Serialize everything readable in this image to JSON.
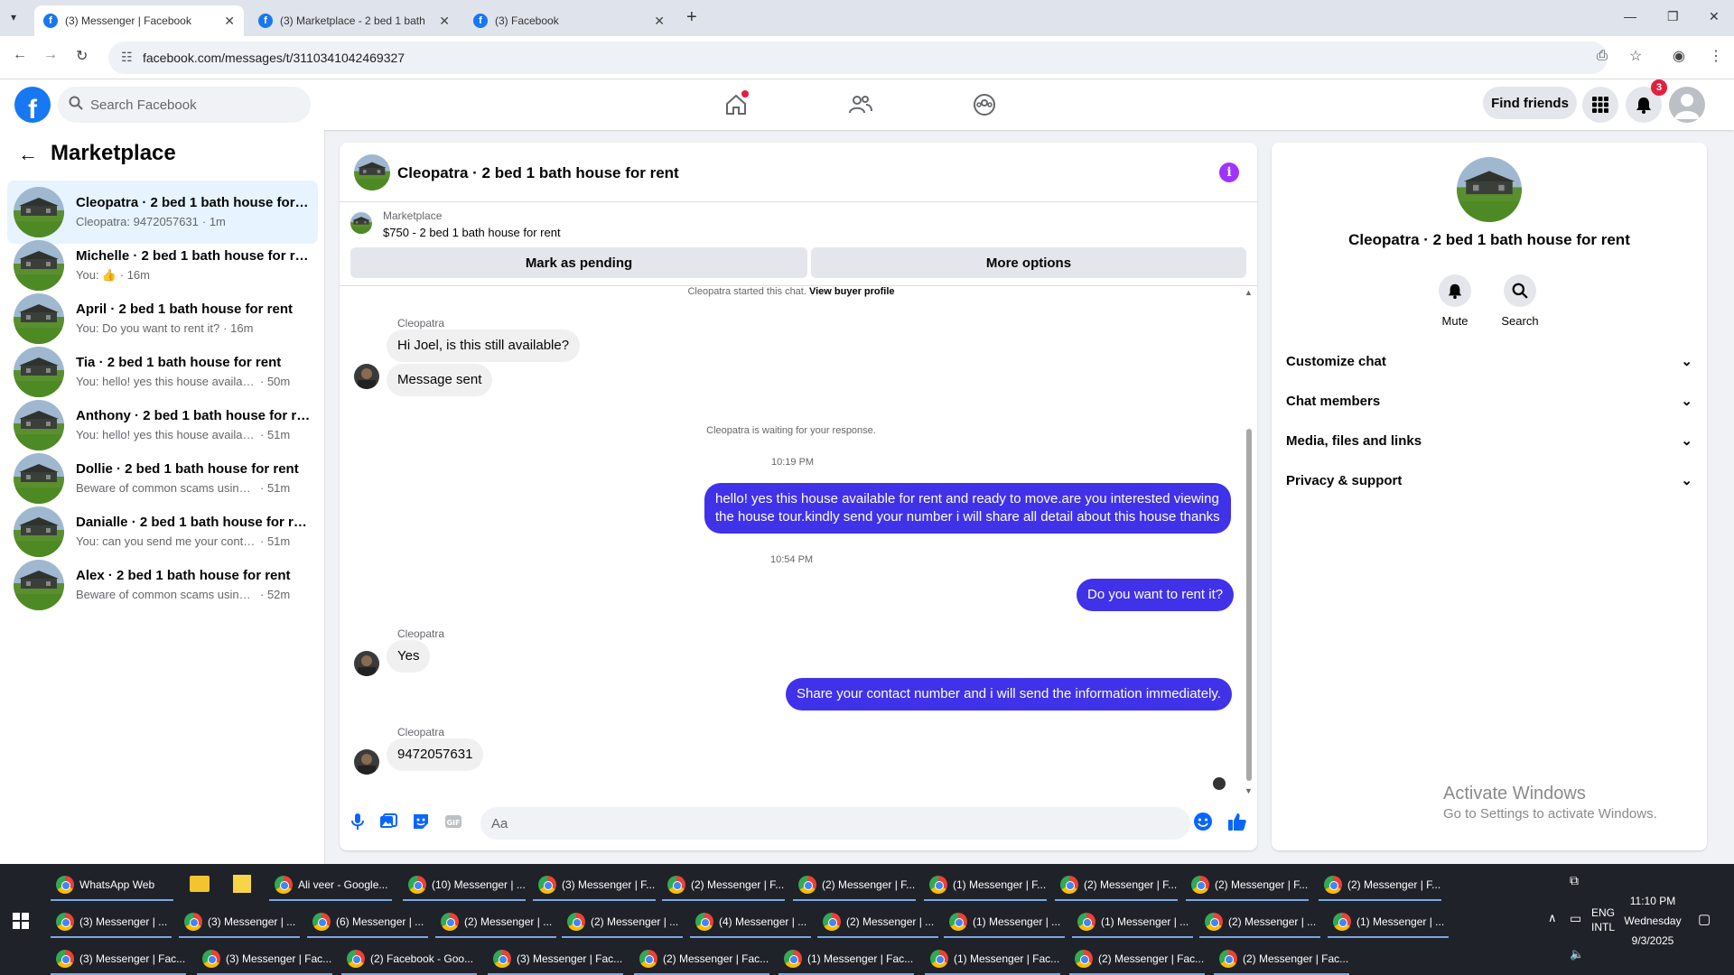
{
  "browser": {
    "tabs": [
      {
        "title": "(3) Messenger | Facebook"
      },
      {
        "title": "(3) Marketplace - 2 bed 1 bath"
      },
      {
        "title": "(3) Facebook"
      }
    ],
    "new_tab": "+",
    "url": "facebook.com/messages/t/3110341042469327"
  },
  "fb": {
    "search_placeholder": "Search Facebook",
    "find_friends": "Find friends",
    "notif_count": "3"
  },
  "sidebar": {
    "title": "Marketplace",
    "conversations": [
      {
        "name": "Cleopatra · 2 bed 1 bath house for rent",
        "snippet": "Cleopatra: 9472057631",
        "time": "· 1m",
        "selected": true
      },
      {
        "name": "Michelle · 2 bed 1 bath house for rent",
        "snippet": "You:",
        "time": "· 16m",
        "thumb": true
      },
      {
        "name": "April · 2 bed 1 bath house for rent",
        "snippet": "You: Do you want to rent it?",
        "time": " · 16m"
      },
      {
        "name": "Tia · 2 bed 1 bath house for rent",
        "snippet": "You: hello! yes this house available for rent",
        "time": "· 50m"
      },
      {
        "name": "Anthony · 2 bed 1 bath house for rent",
        "snippet": "You: hello! yes this house available for rent",
        "time": "· 51m"
      },
      {
        "name": "Dollie · 2 bed 1 bath house for rent",
        "snippet": "Beware of common scams using payment apps",
        "time": "· 51m"
      },
      {
        "name": "Danialle · 2 bed 1 bath house for rent",
        "snippet": "You: can you send me your contact number",
        "time": "· 51m"
      },
      {
        "name": "Alex · 2 bed 1 bath house for rent",
        "snippet": "Beware of common scams using payment apps",
        "time": "· 52m"
      }
    ]
  },
  "chat": {
    "title": "Cleopatra · 2 bed 1 bath house for rent",
    "marketplace_label": "Marketplace",
    "listing": "$750 - 2 bed 1 bath house for rent",
    "mark_pending": "Mark as pending",
    "more_options": "More options",
    "started": "Cleopatra started this chat.",
    "view_profile": "View buyer profile",
    "sender": "Cleopatra",
    "msg1": "Hi Joel, is this still available?",
    "msg2": "Message sent",
    "waiting": "Cleopatra is waiting for your response.",
    "time1": "10:19 PM",
    "out1_line1": "hello! yes this house available for rent and ready to move.are you interested viewing",
    "out1_line2": "the house tour.kindly send your number i will share all detail about this house thanks",
    "time2": "10:54 PM",
    "out2": "Do you want to rent it?",
    "msg3": "Yes",
    "out3": "Share your contact number and i will send the information immediately.",
    "msg4": "9472057631",
    "composer_placeholder": "Aa"
  },
  "panel": {
    "name": "Cleopatra · 2 bed 1 bath house for rent",
    "mute": "Mute",
    "search": "Search",
    "rows": [
      "Customize chat",
      "Chat members",
      "Media, files and links",
      "Privacy & support"
    ],
    "activate_title": "Activate Windows",
    "activate_sub": "Go to Settings to activate Windows."
  },
  "taskbar": {
    "row1": [
      "WhatsApp Web",
      "Ali veer - Google...",
      "(10) Messenger | ...",
      "(3) Messenger | F...",
      "(2) Messenger | F...",
      "(2) Messenger | F...",
      "(1) Messenger | F...",
      "(2) Messenger | F...",
      "(2) Messenger | F...",
      "(2) Messenger | F..."
    ],
    "row2": [
      "(3) Messenger | ...",
      "(3) Messenger | ...",
      "(6) Messenger | ...",
      "(2) Messenger | ...",
      "(2) Messenger | ...",
      "(4) Messenger | ...",
      "(2) Messenger | ...",
      "(1) Messenger | ...",
      "(1) Messenger | ...",
      "(2) Messenger | ...",
      "(1) Messenger | ..."
    ],
    "row3": [
      "(3) Messenger | Fac...",
      "(3) Messenger | Fac...",
      "(2) Facebook - Goo...",
      "(3) Messenger | Fac...",
      "(2) Messenger | Fac...",
      "(1) Messenger | Fac...",
      "(1) Messenger | Fac...",
      "(2) Messenger | Fac...",
      "(2) Messenger | Fac..."
    ],
    "lang1": "ENG",
    "lang2": "INTL",
    "time": "11:10 PM",
    "day": "Wednesday",
    "date": "9/3/2025"
  },
  "colors": {
    "fb_blue": "#1877f2",
    "out_bubble": "#4032e9",
    "selected_row": "#e7f3ff"
  }
}
